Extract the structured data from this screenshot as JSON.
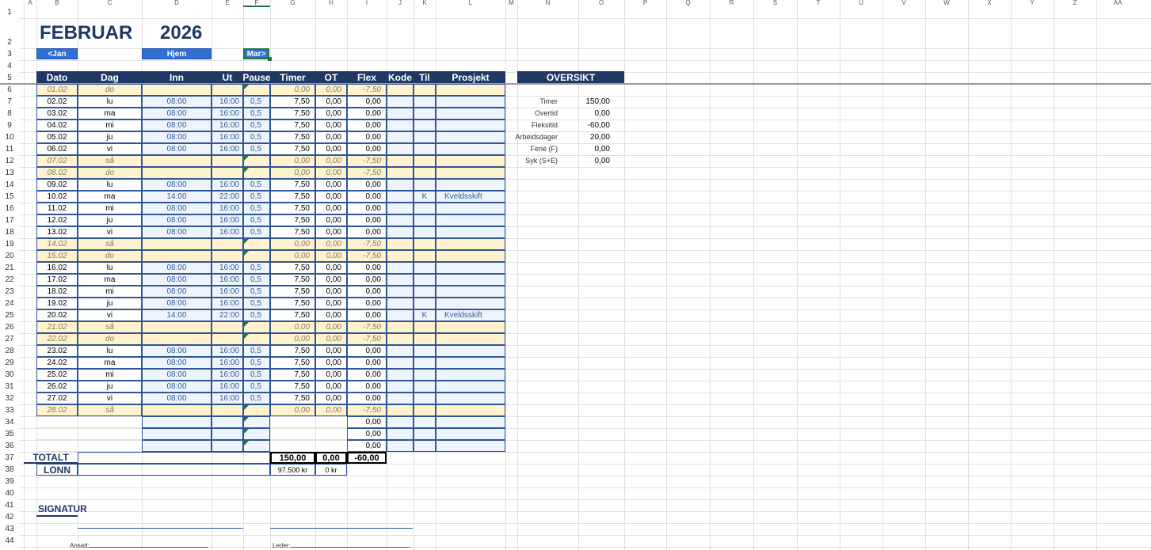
{
  "columns": [
    "A",
    "B",
    "C",
    "D",
    "E",
    "F",
    "G",
    "H",
    "I",
    "J",
    "K",
    "L",
    "M",
    "N",
    "O",
    "P",
    "Q",
    "R",
    "S",
    "T",
    "U",
    "V",
    "W",
    "X",
    "Y",
    "Z",
    "AA"
  ],
  "rows": [
    "1",
    "2",
    "3",
    "4",
    "5",
    "6",
    "7",
    "8",
    "9",
    "10",
    "11",
    "12",
    "13",
    "14",
    "15",
    "16",
    "17",
    "18",
    "19",
    "20",
    "21",
    "22",
    "23",
    "24",
    "25",
    "26",
    "27",
    "28",
    "29",
    "30",
    "31",
    "32",
    "33",
    "34",
    "35",
    "36",
    "37",
    "38",
    "39",
    "40",
    "41",
    "42",
    "43",
    "44"
  ],
  "title": {
    "month": "FEBRUAR",
    "year": "2026"
  },
  "nav": {
    "prev": "<Jan",
    "home": "Hjem",
    "next": "Mar>"
  },
  "table_headers": [
    "Dato",
    "Dag",
    "Inn",
    "Ut",
    "Pause",
    "Timer",
    "OT",
    "Flex",
    "Kode",
    "Til",
    "Prosjekt"
  ],
  "entries": [
    {
      "dato": "01.02",
      "dag": "do",
      "inn": "",
      "ut": "",
      "pause": "",
      "timer": "0,00",
      "ot": "0,00",
      "flex": "-7,50",
      "kode": "",
      "til": "",
      "prosjekt": "",
      "weekend": true
    },
    {
      "dato": "02.02",
      "dag": "lu",
      "inn": "08:00",
      "ut": "16:00",
      "pause": "0,5",
      "timer": "7,50",
      "ot": "0,00",
      "flex": "0,00",
      "kode": "",
      "til": "",
      "prosjekt": "",
      "weekend": false
    },
    {
      "dato": "03.02",
      "dag": "ma",
      "inn": "08:00",
      "ut": "16:00",
      "pause": "0,5",
      "timer": "7,50",
      "ot": "0,00",
      "flex": "0,00",
      "kode": "",
      "til": "",
      "prosjekt": "",
      "weekend": false
    },
    {
      "dato": "04.02",
      "dag": "mi",
      "inn": "08:00",
      "ut": "16:00",
      "pause": "0,5",
      "timer": "7,50",
      "ot": "0,00",
      "flex": "0,00",
      "kode": "",
      "til": "",
      "prosjekt": "",
      "weekend": false
    },
    {
      "dato": "05.02",
      "dag": "ju",
      "inn": "08:00",
      "ut": "16:00",
      "pause": "0,5",
      "timer": "7,50",
      "ot": "0,00",
      "flex": "0,00",
      "kode": "",
      "til": "",
      "prosjekt": "",
      "weekend": false
    },
    {
      "dato": "06.02",
      "dag": "vi",
      "inn": "08:00",
      "ut": "16:00",
      "pause": "0,5",
      "timer": "7,50",
      "ot": "0,00",
      "flex": "0,00",
      "kode": "",
      "til": "",
      "prosjekt": "",
      "weekend": false
    },
    {
      "dato": "07.02",
      "dag": "så",
      "inn": "",
      "ut": "",
      "pause": "",
      "timer": "0,00",
      "ot": "0,00",
      "flex": "-7,50",
      "kode": "",
      "til": "",
      "prosjekt": "",
      "weekend": true
    },
    {
      "dato": "08.02",
      "dag": "do",
      "inn": "",
      "ut": "",
      "pause": "",
      "timer": "0,00",
      "ot": "0,00",
      "flex": "-7,50",
      "kode": "",
      "til": "",
      "prosjekt": "",
      "weekend": true
    },
    {
      "dato": "09.02",
      "dag": "lu",
      "inn": "08:00",
      "ut": "16:00",
      "pause": "0,5",
      "timer": "7,50",
      "ot": "0,00",
      "flex": "0,00",
      "kode": "",
      "til": "",
      "prosjekt": "",
      "weekend": false
    },
    {
      "dato": "10.02",
      "dag": "ma",
      "inn": "14:00",
      "ut": "22:00",
      "pause": "0,5",
      "timer": "7,50",
      "ot": "0,00",
      "flex": "0,00",
      "kode": "",
      "til": "K",
      "prosjekt": "Kveldsskift",
      "weekend": false
    },
    {
      "dato": "11.02",
      "dag": "mi",
      "inn": "08:00",
      "ut": "16:00",
      "pause": "0,5",
      "timer": "7,50",
      "ot": "0,00",
      "flex": "0,00",
      "kode": "",
      "til": "",
      "prosjekt": "",
      "weekend": false
    },
    {
      "dato": "12.02",
      "dag": "ju",
      "inn": "08:00",
      "ut": "16:00",
      "pause": "0,5",
      "timer": "7,50",
      "ot": "0,00",
      "flex": "0,00",
      "kode": "",
      "til": "",
      "prosjekt": "",
      "weekend": false
    },
    {
      "dato": "13.02",
      "dag": "vi",
      "inn": "08:00",
      "ut": "16:00",
      "pause": "0,5",
      "timer": "7,50",
      "ot": "0,00",
      "flex": "0,00",
      "kode": "",
      "til": "",
      "prosjekt": "",
      "weekend": false
    },
    {
      "dato": "14.02",
      "dag": "så",
      "inn": "",
      "ut": "",
      "pause": "",
      "timer": "0,00",
      "ot": "0,00",
      "flex": "-7,50",
      "kode": "",
      "til": "",
      "prosjekt": "",
      "weekend": true
    },
    {
      "dato": "15.02",
      "dag": "do",
      "inn": "",
      "ut": "",
      "pause": "",
      "timer": "0,00",
      "ot": "0,00",
      "flex": "-7,50",
      "kode": "",
      "til": "",
      "prosjekt": "",
      "weekend": true
    },
    {
      "dato": "16.02",
      "dag": "lu",
      "inn": "08:00",
      "ut": "16:00",
      "pause": "0,5",
      "timer": "7,50",
      "ot": "0,00",
      "flex": "0,00",
      "kode": "",
      "til": "",
      "prosjekt": "",
      "weekend": false
    },
    {
      "dato": "17.02",
      "dag": "ma",
      "inn": "08:00",
      "ut": "16:00",
      "pause": "0,5",
      "timer": "7,50",
      "ot": "0,00",
      "flex": "0,00",
      "kode": "",
      "til": "",
      "prosjekt": "",
      "weekend": false
    },
    {
      "dato": "18.02",
      "dag": "mi",
      "inn": "08:00",
      "ut": "16:00",
      "pause": "0,5",
      "timer": "7,50",
      "ot": "0,00",
      "flex": "0,00",
      "kode": "",
      "til": "",
      "prosjekt": "",
      "weekend": false
    },
    {
      "dato": "19.02",
      "dag": "ju",
      "inn": "08:00",
      "ut": "16:00",
      "pause": "0,5",
      "timer": "7,50",
      "ot": "0,00",
      "flex": "0,00",
      "kode": "",
      "til": "",
      "prosjekt": "",
      "weekend": false
    },
    {
      "dato": "20.02",
      "dag": "vi",
      "inn": "14:00",
      "ut": "22:00",
      "pause": "0,5",
      "timer": "7,50",
      "ot": "0,00",
      "flex": "0,00",
      "kode": "",
      "til": "K",
      "prosjekt": "Kveldsskift",
      "weekend": false
    },
    {
      "dato": "21.02",
      "dag": "så",
      "inn": "",
      "ut": "",
      "pause": "",
      "timer": "0,00",
      "ot": "0,00",
      "flex": "-7,50",
      "kode": "",
      "til": "",
      "prosjekt": "",
      "weekend": true
    },
    {
      "dato": "22.02",
      "dag": "do",
      "inn": "",
      "ut": "",
      "pause": "",
      "timer": "0,00",
      "ot": "0,00",
      "flex": "-7,50",
      "kode": "",
      "til": "",
      "prosjekt": "",
      "weekend": true
    },
    {
      "dato": "23.02",
      "dag": "lu",
      "inn": "08:00",
      "ut": "16:00",
      "pause": "0,5",
      "timer": "7,50",
      "ot": "0,00",
      "flex": "0,00",
      "kode": "",
      "til": "",
      "prosjekt": "",
      "weekend": false
    },
    {
      "dato": "24.02",
      "dag": "ma",
      "inn": "08:00",
      "ut": "16:00",
      "pause": "0,5",
      "timer": "7,50",
      "ot": "0,00",
      "flex": "0,00",
      "kode": "",
      "til": "",
      "prosjekt": "",
      "weekend": false
    },
    {
      "dato": "25.02",
      "dag": "mi",
      "inn": "08:00",
      "ut": "16:00",
      "pause": "0,5",
      "timer": "7,50",
      "ot": "0,00",
      "flex": "0,00",
      "kode": "",
      "til": "",
      "prosjekt": "",
      "weekend": false
    },
    {
      "dato": "26.02",
      "dag": "ju",
      "inn": "08:00",
      "ut": "16:00",
      "pause": "0,5",
      "timer": "7,50",
      "ot": "0,00",
      "flex": "0,00",
      "kode": "",
      "til": "",
      "prosjekt": "",
      "weekend": false
    },
    {
      "dato": "27.02",
      "dag": "vi",
      "inn": "08:00",
      "ut": "16:00",
      "pause": "0,5",
      "timer": "7,50",
      "ot": "0,00",
      "flex": "0,00",
      "kode": "",
      "til": "",
      "prosjekt": "",
      "weekend": false
    },
    {
      "dato": "28.02",
      "dag": "så",
      "inn": "",
      "ut": "",
      "pause": "",
      "timer": "0,00",
      "ot": "0,00",
      "flex": "-7,50",
      "kode": "",
      "til": "",
      "prosjekt": "",
      "weekend": true
    },
    {
      "dato": "",
      "dag": "",
      "inn": "",
      "ut": "",
      "pause": "",
      "timer": "",
      "ot": "",
      "flex": "0,00",
      "kode": "",
      "til": "",
      "prosjekt": "",
      "weekend": false,
      "empty": true
    },
    {
      "dato": "",
      "dag": "",
      "inn": "",
      "ut": "",
      "pause": "",
      "timer": "",
      "ot": "",
      "flex": "0,00",
      "kode": "",
      "til": "",
      "prosjekt": "",
      "weekend": false,
      "empty": true
    },
    {
      "dato": "",
      "dag": "",
      "inn": "",
      "ut": "",
      "pause": "",
      "timer": "",
      "ot": "",
      "flex": "0,00",
      "kode": "",
      "til": "",
      "prosjekt": "",
      "weekend": false,
      "empty": true
    }
  ],
  "totals": {
    "label": "TOTALT",
    "timer": "150,00",
    "ot": "0,00",
    "flex": "-60,00"
  },
  "pay": {
    "label": "LONN",
    "timer": "97.500 kr",
    "ot": "0 kr"
  },
  "signature": {
    "title": "SIGNATUR",
    "employee": "Ansatt:",
    "manager": "Leder:"
  },
  "overview": {
    "title": "OVERSIKT",
    "items": [
      {
        "label": "Timer",
        "value": "150,00"
      },
      {
        "label": "Overtid",
        "value": "0,00"
      },
      {
        "label": "Fleksitid",
        "value": "-60,00"
      },
      {
        "label": "Arbeidsdager",
        "value": "20,00"
      },
      {
        "label": "Ferie (F)",
        "value": "0,00"
      },
      {
        "label": "Syk (S+E)",
        "value": "0,00"
      }
    ]
  },
  "colors": {
    "header": "#1f3864",
    "weekend": "#fff2cc",
    "input": "#eef4fb",
    "button": "#2f6fd6",
    "selection": "#217346"
  }
}
